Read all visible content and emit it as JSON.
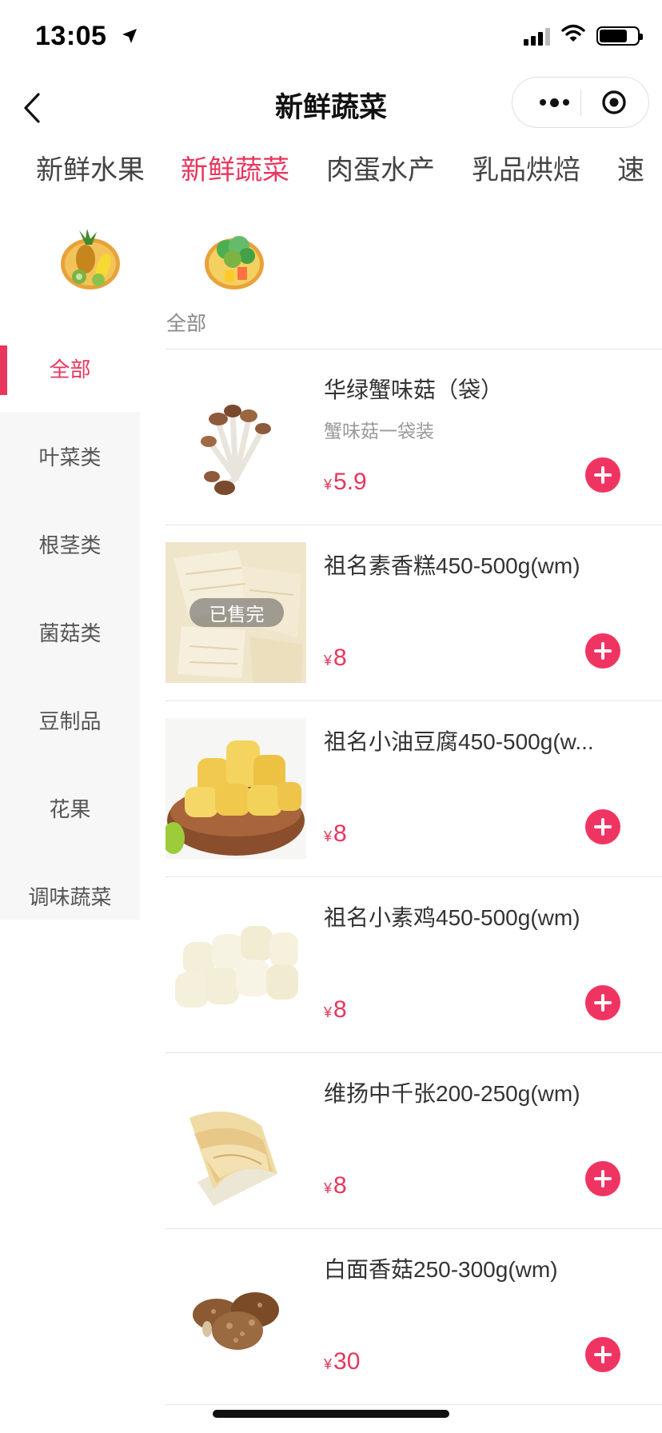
{
  "status_bar": {
    "time": "13:05"
  },
  "nav": {
    "title": "新鲜蔬菜"
  },
  "category_tabs": [
    "新鲜水果",
    "新鲜蔬菜",
    "肉蛋水产",
    "乳品烘焙",
    "速"
  ],
  "section_label": "全部",
  "sidebar": {
    "items": [
      "全部",
      "叶菜类",
      "根茎类",
      "菌菇类",
      "豆制品",
      "花果",
      "调味蔬菜"
    ]
  },
  "products": [
    {
      "name": "华绿蟹味菇（袋）",
      "desc": "蟹味菇一袋装",
      "currency": "¥",
      "price": "5.9"
    },
    {
      "name": "祖名素香糕450-500g(wm)",
      "desc": "",
      "currency": "¥",
      "price": "8",
      "badge": "已售完"
    },
    {
      "name": "祖名小油豆腐450-500g(w...",
      "desc": "",
      "currency": "¥",
      "price": "8"
    },
    {
      "name": "祖名小素鸡450-500g(wm)",
      "desc": "",
      "currency": "¥",
      "price": "8"
    },
    {
      "name": "维扬中千张200-250g(wm)",
      "desc": "",
      "currency": "¥",
      "price": "8"
    },
    {
      "name": "白面香菇250-300g(wm)",
      "desc": "",
      "currency": "¥",
      "price": "30"
    }
  ],
  "colors": {
    "accent": "#e8365d",
    "add_button": "#f03462"
  }
}
